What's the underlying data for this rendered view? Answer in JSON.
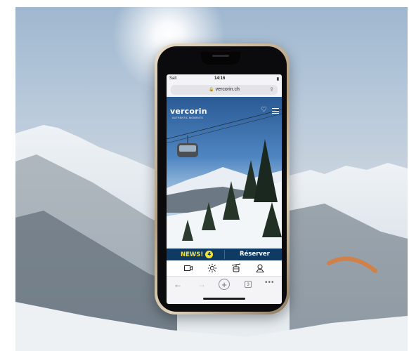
{
  "status_bar": {
    "carrier": "Salt",
    "time": "14:16",
    "battery": "▮"
  },
  "browser": {
    "url": "vercorin.ch",
    "tab_count": "3"
  },
  "site": {
    "logo": "vercorin",
    "tagline": "AUTHENTIC MOMENTS"
  },
  "cta": {
    "news_label": "NEWS!",
    "news_count": "4",
    "reserve_label": "Réserver"
  },
  "icons": {
    "bottom_bar": [
      "webcam-icon",
      "weather-icon",
      "cable-car-icon",
      "map-icon"
    ],
    "browser_nav": [
      "back-icon",
      "forward-icon",
      "new-tab-icon",
      "tabs-icon",
      "more-icon"
    ]
  },
  "colors": {
    "cta_bar": "#0f3a64",
    "news_yellow": "#f1e33a"
  }
}
